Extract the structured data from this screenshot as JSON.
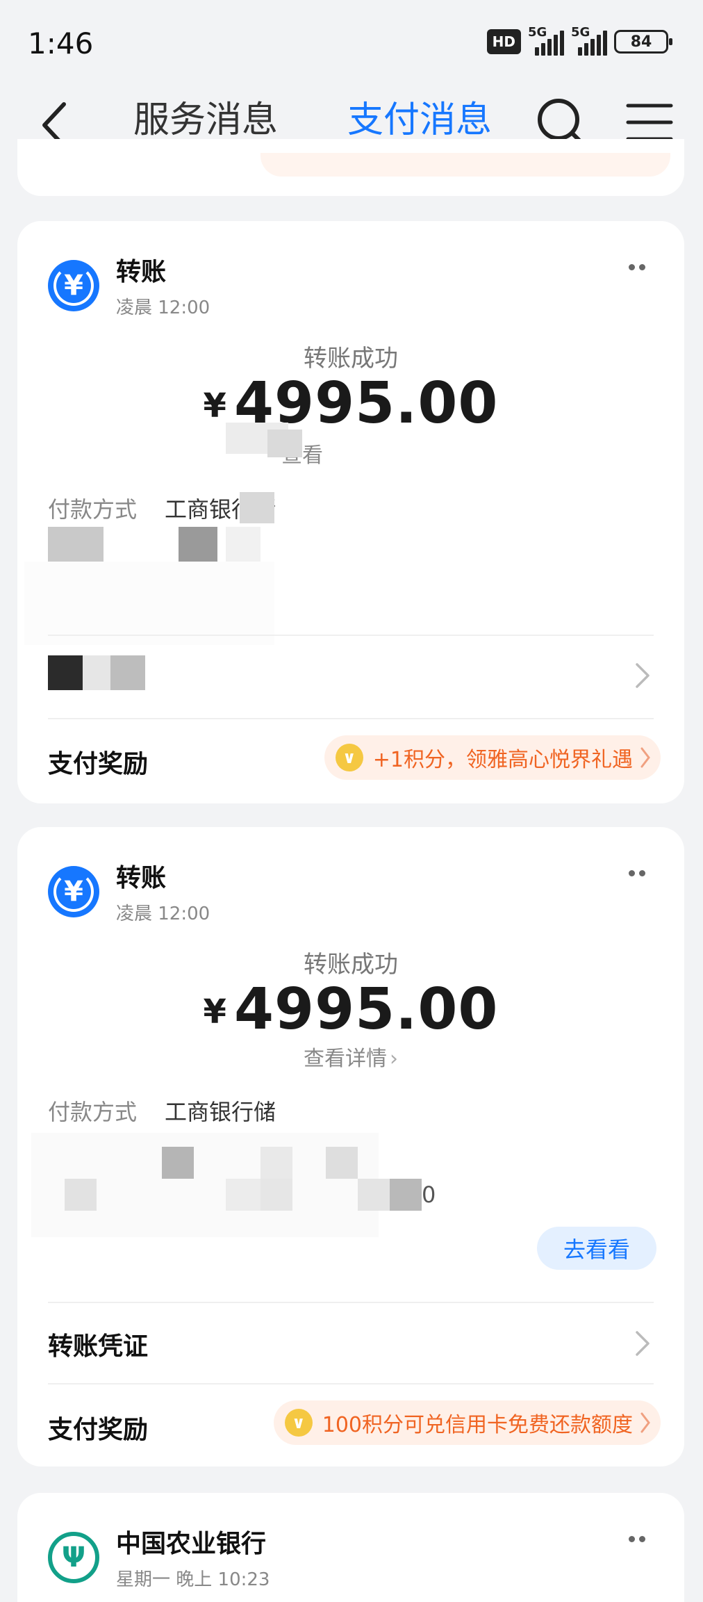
{
  "status_bar": {
    "time": "1:46",
    "hd_label": "HD",
    "net1": "5G",
    "net2": "5G",
    "battery": "84"
  },
  "nav": {
    "tabs": [
      {
        "label": "服务消息",
        "active": false
      },
      {
        "label": "支付消息",
        "active": true
      }
    ],
    "accent_color": "#1677ff"
  },
  "cards": [
    {
      "title": "转账",
      "time": "凌晨 12:00",
      "status": "转账成功",
      "currency": "¥",
      "amount": "4995.00",
      "details_link": "查看",
      "pay_method_label": "付款方式",
      "pay_method_value": "工商银行储",
      "reward_label": "支付奖励",
      "reward_text": "+1积分，领雅高心悦界礼遇"
    },
    {
      "title": "转账",
      "time": "凌晨 12:00",
      "status": "转账成功",
      "currency": "¥",
      "amount": "4995.00",
      "details_link": "查看详情",
      "pay_method_label": "付款方式",
      "pay_method_value": "工商银行储",
      "partial_suffix": "0",
      "go_button": "去看看",
      "voucher_label": "转账凭证",
      "reward_label": "支付奖励",
      "reward_text": "100积分可兑信用卡免费还款额度"
    },
    {
      "title": "中国农业银行",
      "time": "星期一 晚上 10:23"
    }
  ]
}
